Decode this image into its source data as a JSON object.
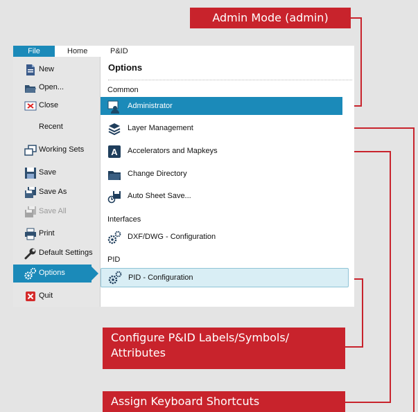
{
  "callouts": {
    "admin_mode": "Admin Mode (admin)",
    "configure_pid_line1": "Configure P&ID Labels/Symbols/",
    "configure_pid_line2": "Attributes",
    "assign_keyboard": "Assign Keyboard Shortcuts"
  },
  "ribbon": {
    "tabs": [
      "File",
      "Home",
      "P&ID"
    ]
  },
  "menu": {
    "items": [
      {
        "label": "New",
        "icon": "new-document-icon"
      },
      {
        "label": "Open...",
        "icon": "open-folder-icon"
      },
      {
        "label": "Close",
        "icon": "close-icon"
      },
      {
        "label": "Recent",
        "icon": ""
      },
      {
        "label": "Working Sets",
        "icon": "working-sets-icon"
      },
      {
        "label": "Save",
        "icon": "save-icon"
      },
      {
        "label": "Save As",
        "icon": "save-as-icon"
      },
      {
        "label": "Save All",
        "icon": "save-all-icon"
      },
      {
        "label": "Print",
        "icon": "print-icon"
      },
      {
        "label": "Default Settings",
        "icon": "wrench-icon"
      },
      {
        "label": "Options",
        "icon": "gears-icon"
      },
      {
        "label": "Quit",
        "icon": "quit-icon"
      }
    ]
  },
  "options": {
    "title": "Options",
    "sections": {
      "common": "Common",
      "interfaces": "Interfaces",
      "pid": "PID"
    },
    "items": [
      {
        "label": "Administrator",
        "icon": "administrator-icon"
      },
      {
        "label": "Layer Management",
        "icon": "layers-icon"
      },
      {
        "label": "Accelerators and Mapkeys",
        "icon": "accelerator-icon"
      },
      {
        "label": "Change Directory",
        "icon": "folder-icon"
      },
      {
        "label": "Auto Sheet Save...",
        "icon": "auto-save-icon"
      },
      {
        "label": "DXF/DWG - Configuration",
        "icon": "gears-icon"
      },
      {
        "label": "PID - Configuration",
        "icon": "gears-icon"
      }
    ]
  },
  "colors": {
    "accent": "#1b8ab9",
    "callout": "#c8232c",
    "hover": "#d9eef5"
  }
}
